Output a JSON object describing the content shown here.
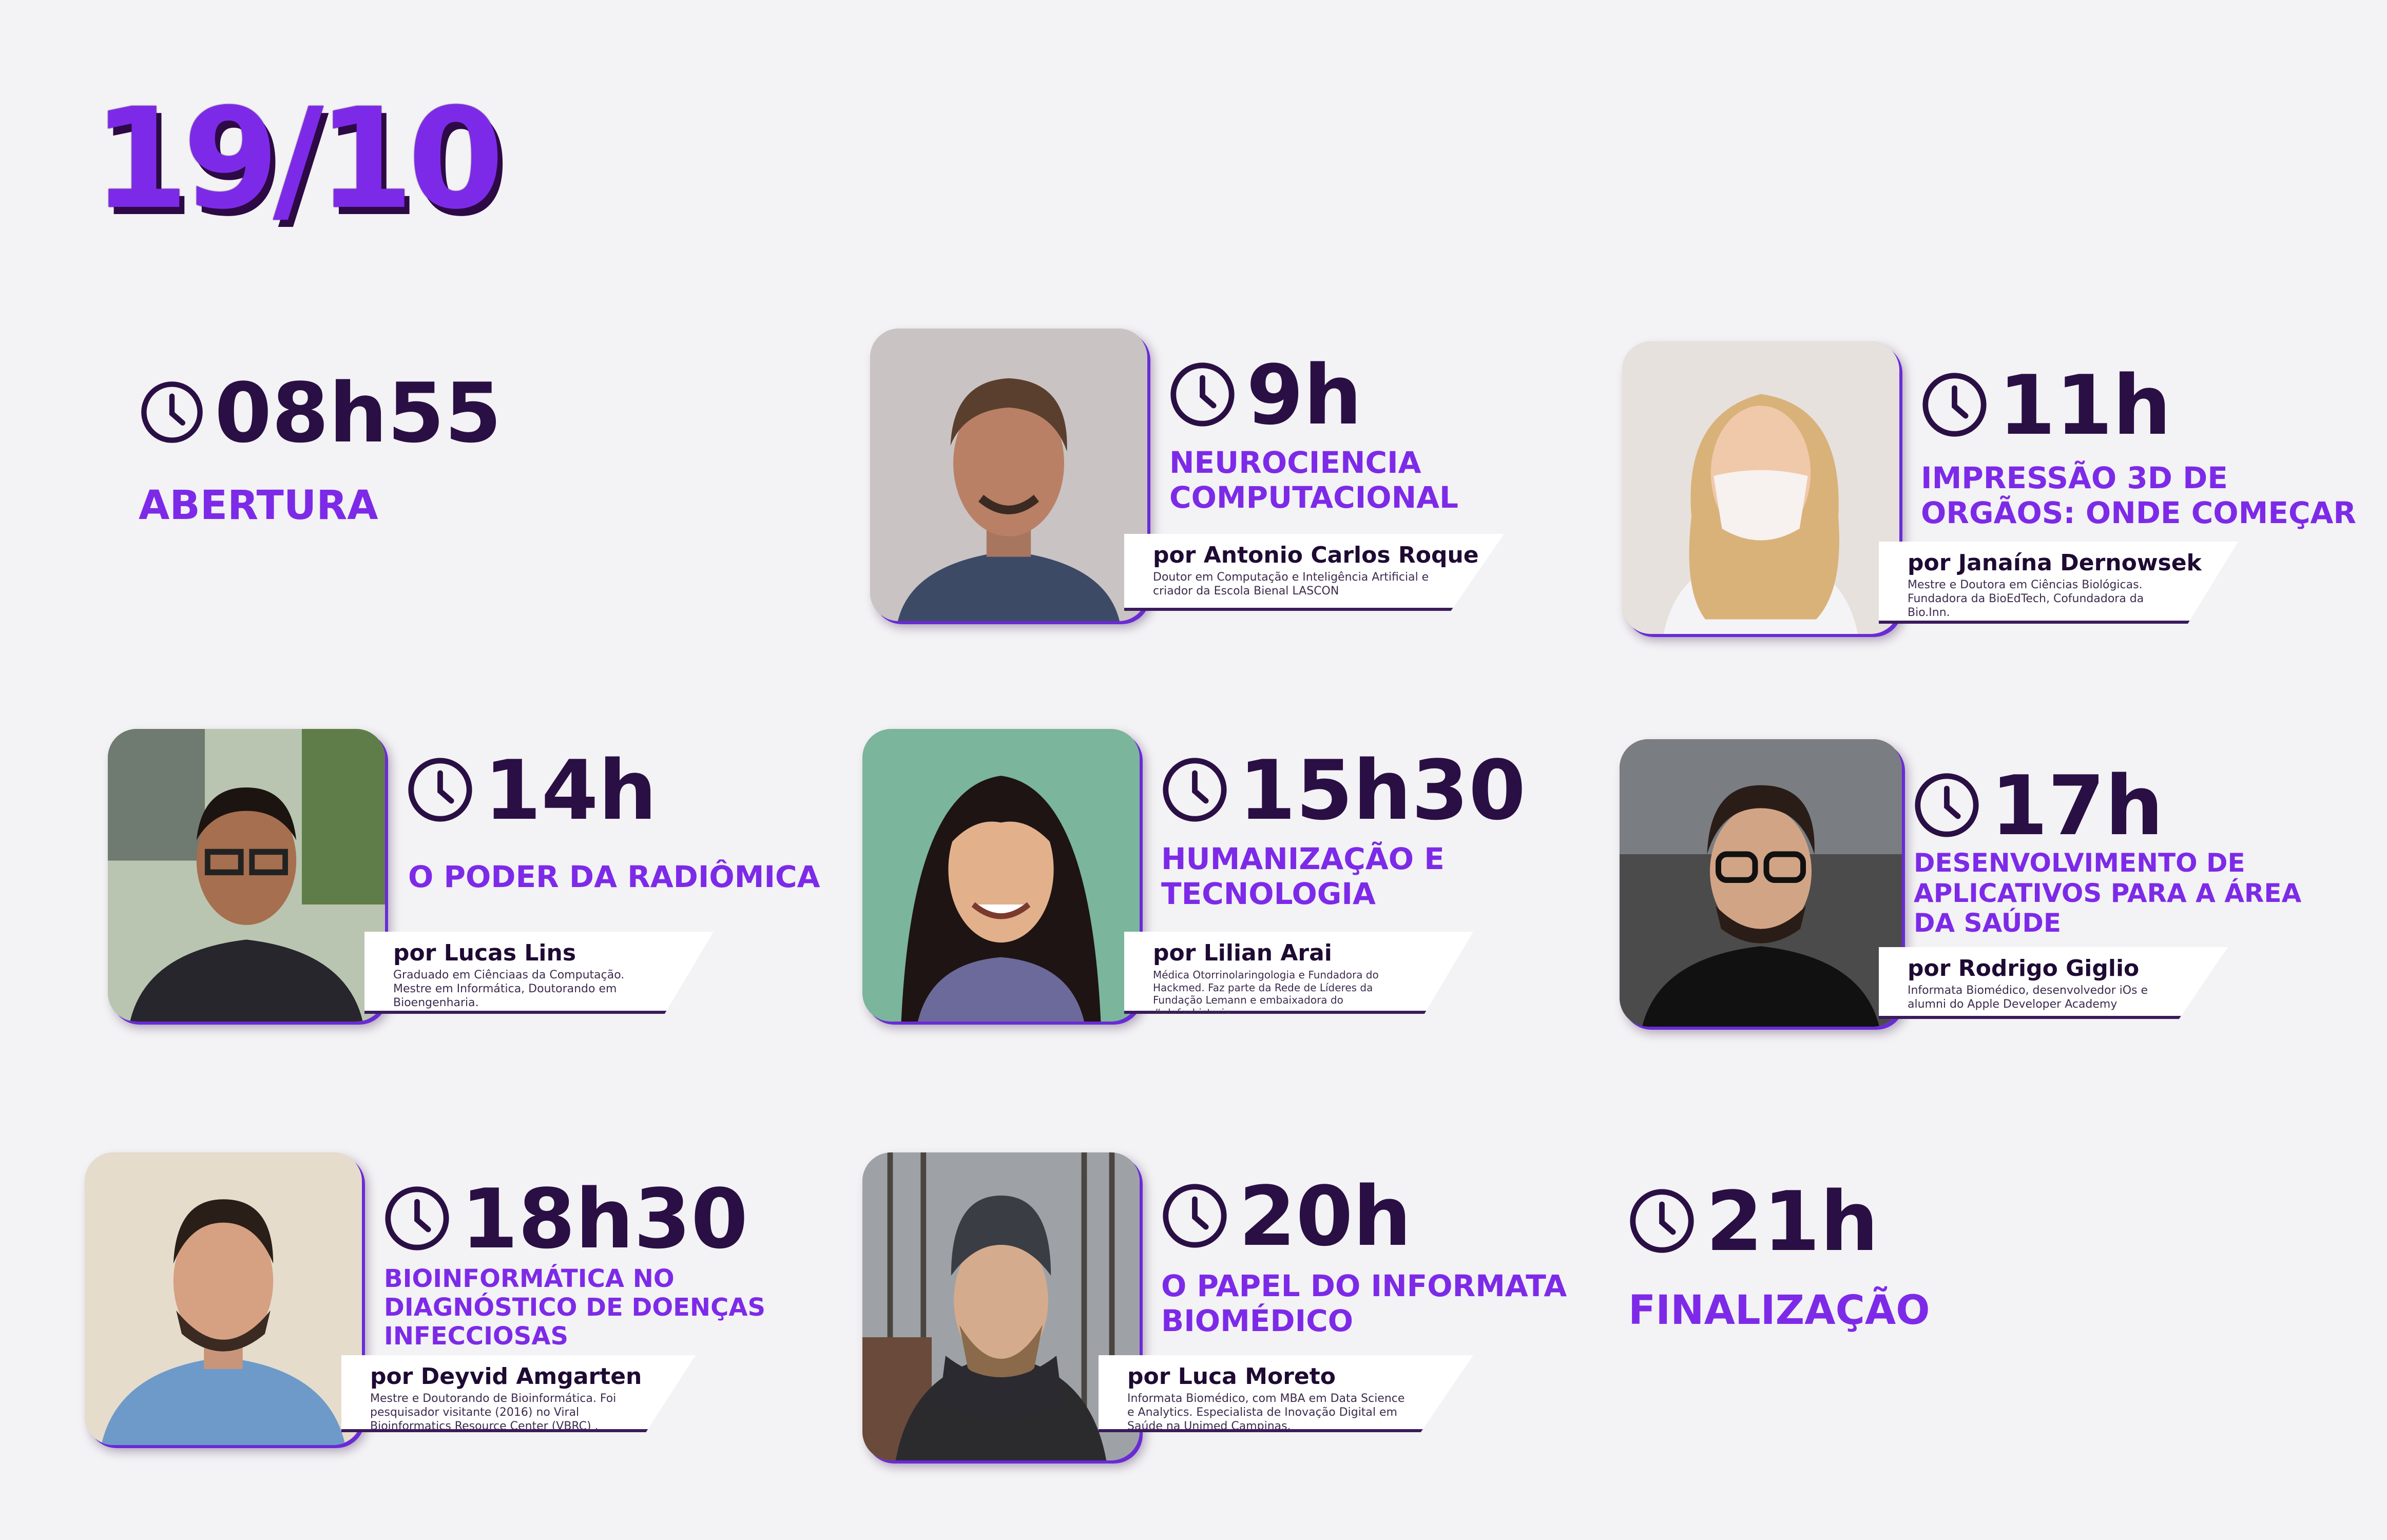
{
  "date": "19/10",
  "sessions": [
    {
      "time": "08h55",
      "title": "ABERTURA"
    },
    {
      "time": "9h",
      "title": "NEUROCIENCIA COMPUTACIONAL",
      "speaker": "por Antonio Carlos Roque",
      "bio": "Doutor em Computação e Inteligência Artificial e criador da Escola Bienal LASCON"
    },
    {
      "time": "11h",
      "title": "IMPRESSÃO 3D DE ORGÃOS: ONDE COMEÇAR",
      "speaker": "por Janaína Dernowsek",
      "bio": "Mestre e Doutora em Ciências Biológicas. Fundadora da BioEdTech, Cofundadora da Bio.Inn."
    },
    {
      "time": "14h",
      "title": "O PODER DA RADIÔMICA",
      "speaker": "por Lucas Lins",
      "bio": "Graduado em Ciênciaas da Computação. Mestre em Informática, Doutorando em Bioengenharia."
    },
    {
      "time": "15h30",
      "title": "HUMANIZAÇÃO E TECNOLOGIA",
      "speaker": "por Lilian Arai",
      "bio": "Médica Otorrinolaringologia e Fundadora do Hackmed. Faz parte da Rede de Líderes da Fundação Lemann e embaixadora do #elafazhistoria."
    },
    {
      "time": "17h",
      "title": "DESENVOLVIMENTO DE APLICATIVOS PARA A ÁREA DA SAÚDE",
      "speaker": "por Rodrigo Giglio",
      "bio": "Informata Biomédico, desenvolvedor iOs e alumni do Apple Developer Academy"
    },
    {
      "time": "18h30",
      "title": "BIOINFORMÁTICA NO DIAGNÓSTICO DE DOENÇAS INFECCIOSAS",
      "speaker": "por Deyvid Amgarten",
      "bio": "Mestre e Doutorando de Bioinformática. Foi pesquisador visitante (2016) no Viral Bioinformatics Resource Center (VBRC) ."
    },
    {
      "time": "20h",
      "title": "O PAPEL DO INFORMATA BIOMÉDICO",
      "speaker": "por Luca Moreto",
      "bio": "Informata Biomédico, com MBA em Data Science e Analytics. Especialista de Inovação Digital em Saúde na Unimed Campinas."
    },
    {
      "time": "21h",
      "title": "FINALIZAÇÃO"
    }
  ],
  "colors": {
    "accent": "#7d2ae8",
    "dark": "#2a0f45",
    "background": "#f3f2f4"
  },
  "icons": {
    "clock": "clock-icon"
  }
}
